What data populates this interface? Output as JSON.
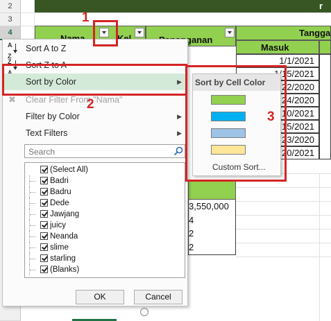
{
  "sheet": {
    "row_numbers": [
      "2",
      "3",
      "4"
    ],
    "headers": {
      "name": "Nama",
      "kelas_fragment": "Kel",
      "penanganan": "Penanganan",
      "tanggal": "Tangga",
      "masuk": "Masuk",
      "top_right_fragment": "r"
    },
    "date_cells": [
      "1/1/2021",
      "1/15/2021",
      "22/2020",
      "24/2020",
      "10/2021",
      "15/2021",
      "23/2020",
      "20/2021"
    ],
    "value_cells": [
      "3,550,000",
      "4",
      "2",
      "2"
    ]
  },
  "filter_menu": {
    "sort_az": "Sort A to Z",
    "sort_za": "Sort Z to A",
    "sort_by_color": "Sort by Color",
    "clear_filter": "Clear Filter From \"Nama\"",
    "filter_by_color": "Filter by Color",
    "text_filters": "Text Filters",
    "search_placeholder": "Search",
    "items": [
      "(Select All)",
      "Badri",
      "Badru",
      "Dede",
      "Jawjang",
      "juicy",
      "Neanda",
      "slime",
      "starling",
      "(Blanks)"
    ],
    "ok": "OK",
    "cancel": "Cancel"
  },
  "color_submenu": {
    "title": "Sort by Cell Color",
    "colors": [
      "#92d050",
      "#00b0f0",
      "#9dc3e6",
      "#ffe699"
    ],
    "custom_sort": "Custom Sort..."
  },
  "annotations": {
    "labels": [
      "1",
      "2",
      "3"
    ],
    "color": "#d42424"
  }
}
